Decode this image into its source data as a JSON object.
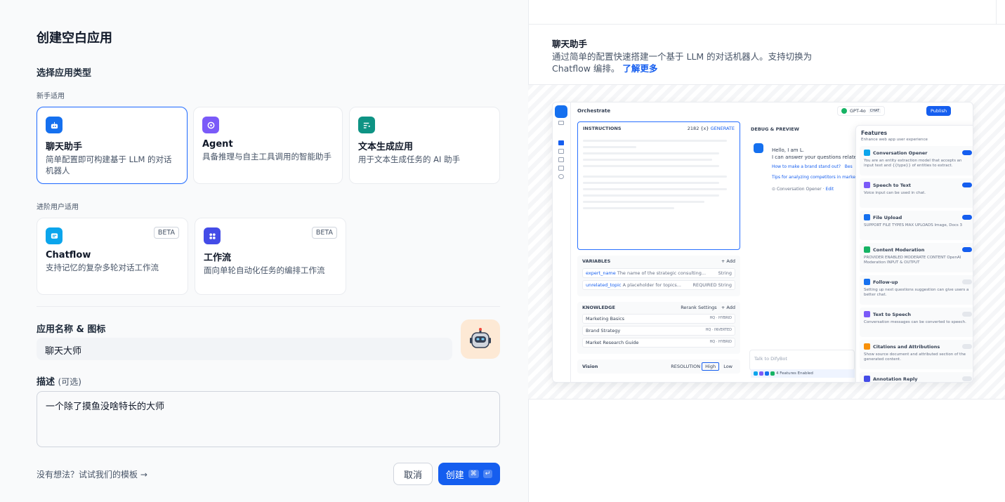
{
  "page_title": "创建空白应用",
  "select_type_label": "选择应用类型",
  "beginner_label": "新手适用",
  "advanced_label": "进阶用户适用",
  "beginner_cards": [
    {
      "title": "聊天助手",
      "desc": "简单配置即可构建基于 LLM 的对话机器人",
      "color": "#1570ef",
      "icon": "chat-bot-icon"
    },
    {
      "title": "Agent",
      "desc": "具备推理与自主工具调用的智能助手",
      "color": "#7a5af8",
      "icon": "agent-icon"
    },
    {
      "title": "文本生成应用",
      "desc": "用于文本生成任务的 AI 助手",
      "color": "#0e9384",
      "icon": "text-gen-icon"
    }
  ],
  "advanced_cards": [
    {
      "title": "Chatflow",
      "desc": "支持记忆的复杂多轮对话工作流",
      "badge": "BETA",
      "color": "#0ba5ec",
      "icon": "chatflow-icon"
    },
    {
      "title": "工作流",
      "desc": "面向单轮自动化任务的编排工作流",
      "badge": "BETA",
      "color": "#444ce7",
      "icon": "workflow-icon"
    }
  ],
  "name_section_label": "应用名称 & 图标",
  "app_name_value": "聊天大师",
  "desc_label": "描述",
  "desc_optional": "(可选)",
  "desc_value": "一个除了摸鱼没啥特长的大师",
  "template_link": "没有想法？试试我们的模板 →",
  "cancel_label": "取消",
  "create_label": "创建",
  "create_kbd": [
    "⌘",
    "↵"
  ],
  "preview": {
    "title": "聊天助手",
    "desc": "通过简单的配置快速搭建一个基于 LLM 的对话机器人。支持切换为 Chatflow 编排。",
    "learn_more": "了解更多",
    "orchestrate": "Orchestrate",
    "model": "GPT-4o",
    "model_tag": "CHAT",
    "publish": "Publish",
    "instructions": "INSTRUCTIONS",
    "instr_count": "2182",
    "instr_var": "{x}",
    "generate": "GENERATE",
    "variables": "VARIABLES",
    "add": "Add",
    "vars": [
      {
        "name": "expert_name",
        "desc": "The name of the strategic consulting...",
        "type": "String"
      },
      {
        "name": "unrelated_topic",
        "desc": "A placeholder for topics...",
        "req": "REQUIRED",
        "type": "String"
      }
    ],
    "knowledge": "KNOWLEDGE",
    "rerank": "Rerank Settings",
    "kb": [
      {
        "name": "Marketing Basics",
        "tag": "HQ · HYBRID"
      },
      {
        "name": "Brand Strategy",
        "tag": "HQ · INVERTED"
      },
      {
        "name": "Market Research Guide",
        "tag": "HQ · HYBRID"
      }
    ],
    "vision": "Vision",
    "resolution": "RESOLUTION",
    "high": "High",
    "low": "Low",
    "debug": "DEBUG & PREVIEW",
    "hello": "Hello, I am L.",
    "answer": "I can answer your questions related",
    "sugg1": "How to make a brand stand out?",
    "sugg1b": "Bes",
    "sugg2": "Tips for analyzing competitors in market",
    "opener": "Conversation Opener",
    "edit": "Edit",
    "talk": "Talk to DifyBot",
    "features_enabled": "4 Features Enabled",
    "features_title": "Features",
    "features_sub": "Enhance web app user experience",
    "features": [
      {
        "name": "Conversation Opener",
        "desc": "You are an entity extraction model that accepts an input text and {{type}} of entities to extract.",
        "on": true,
        "color": "#0ba5ec"
      },
      {
        "name": "Speech to Text",
        "desc": "Voice input can be used in chat.",
        "on": true,
        "color": "#7a5af8"
      },
      {
        "name": "File Upload",
        "desc": "SUPPORT FILE TYPES   MAX UPLOADS  Image, Docs   3",
        "on": true,
        "color": "#1570ef"
      },
      {
        "name": "Content Moderation",
        "desc": "PROVIDER   ENABLED MODERATE CONTENT  OpenAI Moderation   INPUT & OUTPUT",
        "on": true,
        "color": "#16b364"
      },
      {
        "name": "Follow-up",
        "desc": "Setting up next questions suggestion can give users a better chat.",
        "on": false,
        "color": "#1570ef"
      },
      {
        "name": "Text to Speech",
        "desc": "Conversation messages can be converted to speech.",
        "on": false,
        "color": "#7a5af8"
      },
      {
        "name": "Citations and Attributions",
        "desc": "Show source document and attributed section of the generated content.",
        "on": false,
        "color": "#f79009"
      },
      {
        "name": "Annotation Reply",
        "desc": "",
        "on": false,
        "color": "#444ce7"
      }
    ]
  }
}
